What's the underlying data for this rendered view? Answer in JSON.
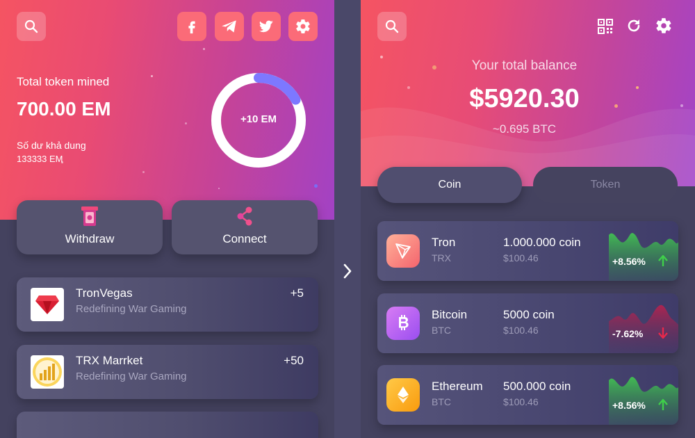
{
  "left": {
    "stats": {
      "total_label": "Total token mined",
      "total_value": "700.00 EM",
      "available_label": "Số dư khả dung",
      "available_value": "133333 EM"
    },
    "donut": {
      "label": "+10 EM",
      "progress": 0.17
    },
    "actions": [
      {
        "label": "Withdraw",
        "icon": "atm-card-icon"
      },
      {
        "label": "Connect",
        "icon": "share-icon"
      }
    ],
    "list": [
      {
        "title": "TronVegas",
        "subtitle": "Redefining War Gaming",
        "count": "+5",
        "icon": "ruby-icon"
      },
      {
        "title": "TRX Marrket",
        "subtitle": "Redefining War Gaming",
        "count": "+50",
        "icon": "bars-chart-icon"
      }
    ]
  },
  "right": {
    "balance_label": "Your total balance",
    "balance_amount": "$5920.30",
    "balance_btc": "~0.695 BTC",
    "tabs": [
      {
        "label": "Coin",
        "active": true
      },
      {
        "label": "Token",
        "active": false
      }
    ],
    "coins": [
      {
        "name": "Tron",
        "symbol": "TRX",
        "amount": "1.000.000 coin",
        "usd": "$100.46",
        "change": "+8.56%",
        "trend": "up",
        "icon": "tron-icon"
      },
      {
        "name": "Bitcoin",
        "symbol": "BTC",
        "amount": "5000 coin",
        "usd": "$100.46",
        "change": "-7.62%",
        "trend": "down",
        "icon": "bitcoin-icon"
      },
      {
        "name": "Ethereum",
        "symbol": "BTC",
        "amount": "500.000 coin",
        "usd": "$100.46",
        "change": "+8.56%",
        "trend": "up",
        "icon": "ethereum-icon"
      }
    ]
  },
  "colors": {
    "up": "#3fcf4a",
    "down": "#e8284b",
    "panel_bg": "#44425f",
    "hero_start": "#f55462",
    "hero_end": "#a242c4"
  }
}
